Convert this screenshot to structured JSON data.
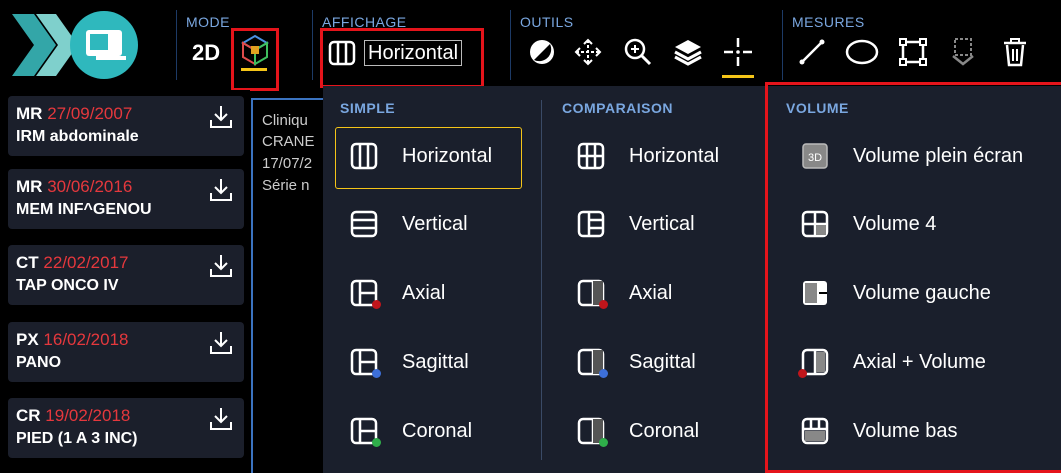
{
  "toolbar": {
    "mode": {
      "label": "MODE",
      "two_d": "2D"
    },
    "affichage": {
      "label": "AFFICHAGE",
      "current": "Horizontal"
    },
    "outils": {
      "label": "OUTILS"
    },
    "mesures": {
      "label": "MESURES"
    }
  },
  "studies": [
    {
      "modality": "MR",
      "date": "27/09/2007",
      "desc": "IRM abdominale"
    },
    {
      "modality": "MR",
      "date": "30/06/2016",
      "desc": "MEM INF^GENOU"
    },
    {
      "modality": "CT",
      "date": "22/02/2017",
      "desc": "TAP ONCO IV"
    },
    {
      "modality": "PX",
      "date": "16/02/2018",
      "desc": "PANO"
    },
    {
      "modality": "CR",
      "date": "19/02/2018",
      "desc": "PIED (1 A 3 INC)"
    }
  ],
  "viewer": {
    "lines": [
      "Cliniqu",
      "CRANE",
      "17/07/2",
      "Série n"
    ]
  },
  "layout_menu": {
    "simple": {
      "heading": "SIMPLE",
      "items": [
        "Horizontal",
        "Vertical",
        "Axial",
        "Sagittal",
        "Coronal"
      ]
    },
    "comparaison": {
      "heading": "COMPARAISON",
      "items": [
        "Horizontal",
        "Vertical",
        "Axial",
        "Sagittal",
        "Coronal"
      ]
    },
    "volume": {
      "heading": "VOLUME",
      "items": [
        "Volume plein écran",
        "Volume 4",
        "Volume gauche",
        "Axial + Volume",
        "Volume bas"
      ]
    }
  },
  "colors": {
    "accent_yellow": "#f5c518",
    "highlight_red": "#e5141b",
    "label_blue": "#7aa7e0",
    "date_red": "#e5383d",
    "dot_red": "#c0151b",
    "dot_blue": "#3d6fd8",
    "dot_green": "#2fae4a"
  }
}
